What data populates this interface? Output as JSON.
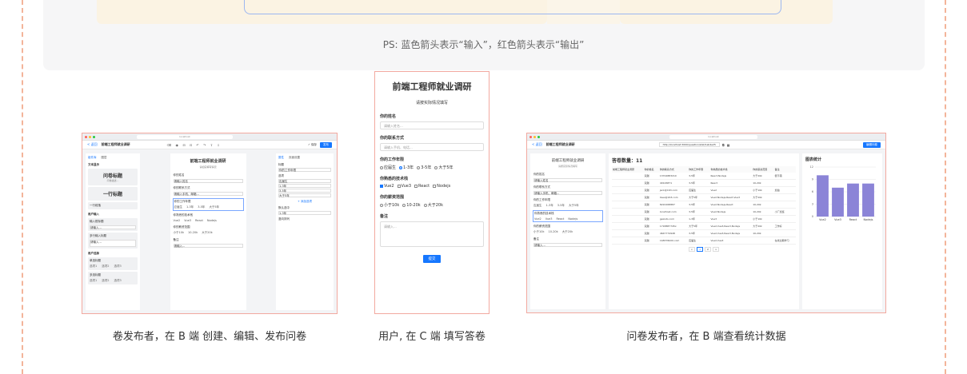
{
  "header_note": "PS: 蓝色箭头表示“输入”，红色箭头表示“输出”",
  "captions": {
    "editor": "卷发布者，在 B 端 创建、编辑、发布问卷",
    "user": "用户, 在 C 端 填写答卷",
    "stats": "问卷发布者，在 B 端查看统计数据"
  },
  "editor": {
    "url": "localhost",
    "back": "< 返回",
    "title": "前端工程师就业调研",
    "tools": "⌫ ◉ ⊟ ⊡ ↶ ↷ ⇧ ⇩",
    "save": "✓ 保存",
    "publish": "发布",
    "left_tabs": [
      "组件库",
      "图层"
    ],
    "groups": [
      {
        "name": "文本显示",
        "items": [
          "问卷标题",
          "一行标题",
          "一行段落"
        ]
      },
      {
        "name": "用户输入",
        "items": [
          "输入框标题",
          "多行输入标题"
        ]
      },
      {
        "name": "用户选择",
        "items": [
          "单选标题",
          "多选标题"
        ]
      }
    ],
    "subtext": "问卷描述...",
    "placeholder": "请输入...",
    "option_labels": [
      "选项1",
      "选项2",
      "选项3"
    ],
    "canvas_title": "前端工程师就业调研",
    "canvas_subtitle": "请如实填写情况",
    "canvas_questions": [
      "你的姓名",
      "你的联系方式",
      "你的工作年限",
      "你熟悉的技术栈",
      "你的薪资范围",
      "备注"
    ],
    "canvas_placeholders": [
      "请输入姓名",
      "请输入手机、邮箱..."
    ],
    "canvas_years": [
      "应届生",
      "1-3年",
      "3-5年",
      "大于5年"
    ],
    "canvas_tech": [
      "Vue2",
      "Vue3",
      "React",
      "Nodejs"
    ],
    "canvas_salary": [
      "小于10k",
      "10-20k",
      "大于20k"
    ],
    "right_tabs": [
      "属性",
      "页面设置"
    ],
    "props": [
      "标题",
      "你的工作年限",
      "选项",
      "应届生",
      "1-3年",
      "3-5年",
      "大于5年"
    ],
    "add_option": "+ 添加选项",
    "prop_layout": "默认选中",
    "prop_select": "1-3年",
    "prop_vertical": "竖向排列"
  },
  "mobile": {
    "title": "前端工程师就业调研",
    "subtitle": "请按实际情况填写",
    "q1": "你的姓名",
    "q1_placeholder": "请输入姓名...",
    "q2": "你的联系方式",
    "q2_placeholder": "请输入手机、电话...",
    "q3": "你的工作年限",
    "q3_options": [
      "应届生",
      "1-3年",
      "3-5年",
      "大于5年"
    ],
    "q4": "你熟悉的技术栈",
    "q4_options": [
      "Vue2",
      "Vue3",
      "React",
      "Nodejs"
    ],
    "q5": "你的薪资范围",
    "q5_options": [
      "小于10k",
      "10-20k",
      "大于20k"
    ],
    "q6": "备注",
    "q6_placeholder": "请输入...",
    "submit": "提交"
  },
  "stats": {
    "url": "http://localhost:3000/question/stat/1eb4e25",
    "back": "< 返回",
    "title": "前端工程师就业调研",
    "copy": "⧉",
    "qr": "▦",
    "edit": "编辑问卷",
    "canvas_title": "前端工程师就业调研",
    "canvas_subtitle": "请按实际情况填写",
    "questions": [
      "你的姓名",
      "你的联系方式",
      "你的工作年限",
      "你熟悉的技术栈",
      "你的薪资范围",
      "备注"
    ],
    "placeholders": [
      "请输入姓名",
      "请输入手机、邮箱..."
    ],
    "years": [
      "应届生",
      "1-3年",
      "3-5年",
      "大于5年"
    ],
    "tech": [
      "Vue2",
      "Vue3",
      "React",
      "Nodejs"
    ],
    "salary": [
      "小于10k",
      "10-20k",
      "大于20k"
    ],
    "count_label": "答卷数量：11",
    "columns": [
      "前端工程师就业调研",
      "你的姓名",
      "你的联系方式",
      "你的工作年限",
      "你熟悉的技术栈",
      "你的薪资范围",
      "备注"
    ],
    "rows": [
      [
        "",
        "双越",
        "13744883210",
        "3-5年",
        "React,Nodejs",
        "大于20k",
        "很不错"
      ],
      [
        "",
        "双越",
        "40126871",
        "3-5年",
        "React",
        "10-20k",
        ""
      ],
      [
        "",
        "双越",
        "jack@163.com",
        "应届生",
        "Vue2",
        "小于10k",
        "加油"
      ],
      [
        "",
        "双越",
        "liwei@163.com",
        "大于5年",
        "Vue2,Nodejs,React,Vue3",
        "大于20k",
        ""
      ],
      [
        "",
        "双越",
        "8222268887",
        "3-5年",
        "Vue2,Nodejs,React",
        "10-20k",
        ""
      ],
      [
        "",
        "双越",
        "localhost.com",
        "3-5年",
        "Vue2,Nodejs",
        "10-20k",
        "小厂加班"
      ],
      [
        "",
        "双越",
        "gexisto.com",
        "1-3年",
        "Vue3",
        "小于10k",
        ""
      ],
      [
        "",
        "双越",
        "1718887745x",
        "大于5年",
        "Vue2,Vue3,React,Nodejs",
        "大于20k",
        "工作好"
      ],
      [
        "",
        "双越",
        "4647774948",
        "3-5年",
        "Vue2,Vue3,React,Nodejs",
        "10-20k",
        ""
      ],
      [
        "",
        "双越",
        "1b8376b00.com",
        "应届生",
        "Vue2,Vue3",
        "",
        "在线过期学习"
      ]
    ],
    "pager": [
      "<",
      "1",
      "2",
      ">"
    ],
    "chart_title": "图表统计"
  },
  "chart_data": {
    "type": "bar",
    "categories": [
      "Vue2",
      "Vue3",
      "React",
      "Nodejs"
    ],
    "values": [
      10,
      7,
      8,
      8
    ],
    "ylim": [
      0,
      12
    ],
    "yticks": [
      0,
      3,
      6,
      9,
      12
    ],
    "grid": true,
    "color": "#8b84d7"
  }
}
